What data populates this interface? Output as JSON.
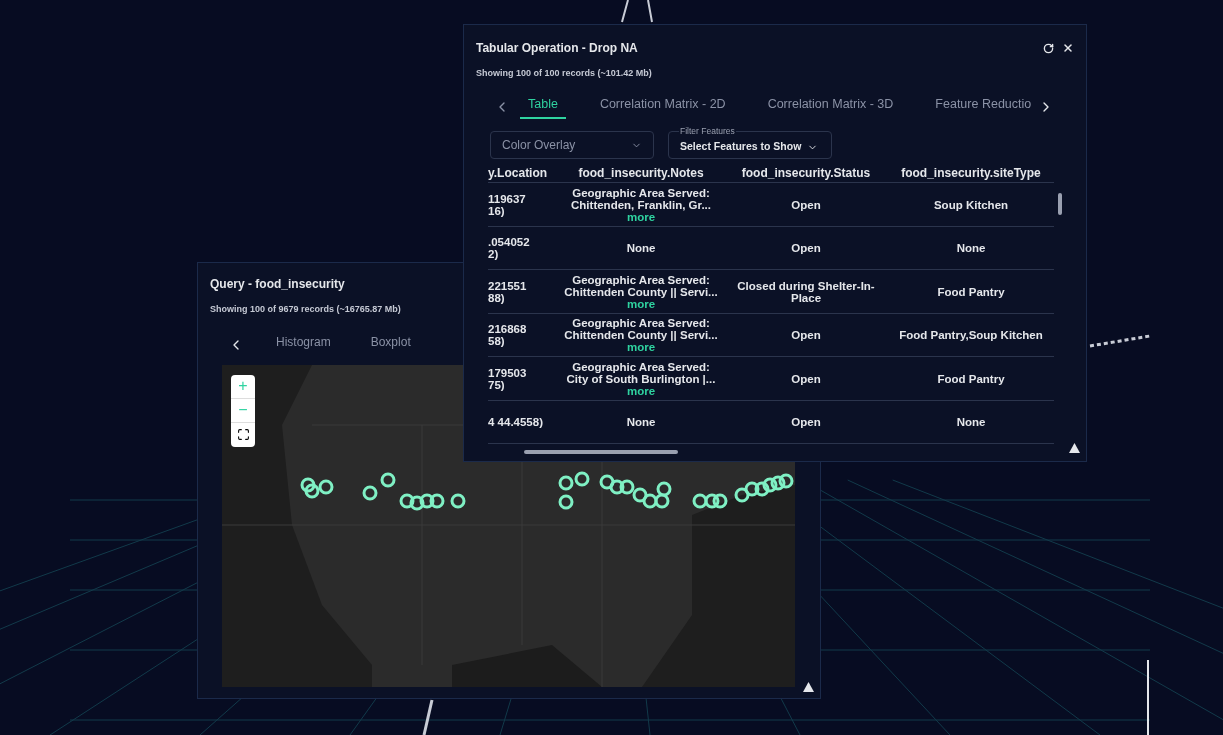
{
  "query_window": {
    "title": "Query - food_insecurity",
    "subtitle": "Showing 100 of 9679 records (~16765.87 Mb)",
    "tabs": [
      {
        "label": "Histogram",
        "selected": false
      },
      {
        "label": "Boxplot",
        "selected": false
      }
    ],
    "map": {
      "kind": "picture",
      "controls": [
        "+",
        "−"
      ]
    }
  },
  "table_window": {
    "title": "Tabular Operation - Drop NA",
    "subtitle": "Showing 100 of 100 records (~101.42 Mb)",
    "tabs": [
      {
        "label": "Table",
        "selected": true
      },
      {
        "label": "Correlation Matrix - 2D",
        "selected": false
      },
      {
        "label": "Correlation Matrix - 3D",
        "selected": false
      },
      {
        "label": "Feature Reductio",
        "selected": false
      }
    ],
    "color_overlay": {
      "placeholder": "Color Overlay"
    },
    "filter": {
      "legend": "Filter Features",
      "value": "Select Features to Show"
    },
    "table": {
      "columns": [
        "y.Location",
        "food_insecurity.Notes",
        "food_insecurity.Status",
        "food_insecurity.siteType"
      ],
      "rows": [
        {
          "location": "119637\n16)",
          "notes": "Geographic Area Served: Chittenden, Franklin, Gr...",
          "more": "more",
          "status": "Open",
          "site_type": "Soup Kitchen"
        },
        {
          "location": ".054052\n2)",
          "notes": "None",
          "status": "Open",
          "site_type": "None"
        },
        {
          "location": "221551\n88)",
          "notes": "Geographic Area Served: Chittenden County || Servi...",
          "more": "more",
          "status": "Closed during Shelter-In-Place",
          "site_type": "Food Pantry"
        },
        {
          "location": "216868\n58)",
          "notes": "Geographic Area Served: Chittenden County || Servi...",
          "more": "more",
          "status": "Open",
          "site_type": "Food Pantry,Soup Kitchen"
        },
        {
          "location": "179503\n75)",
          "notes": "Geographic Area Served: City of South Burlington |...",
          "more": "more",
          "status": "Open",
          "site_type": "Food Pantry"
        },
        {
          "location": "4 44.4558)",
          "notes": "None",
          "status": "Open",
          "site_type": "None"
        }
      ]
    }
  }
}
